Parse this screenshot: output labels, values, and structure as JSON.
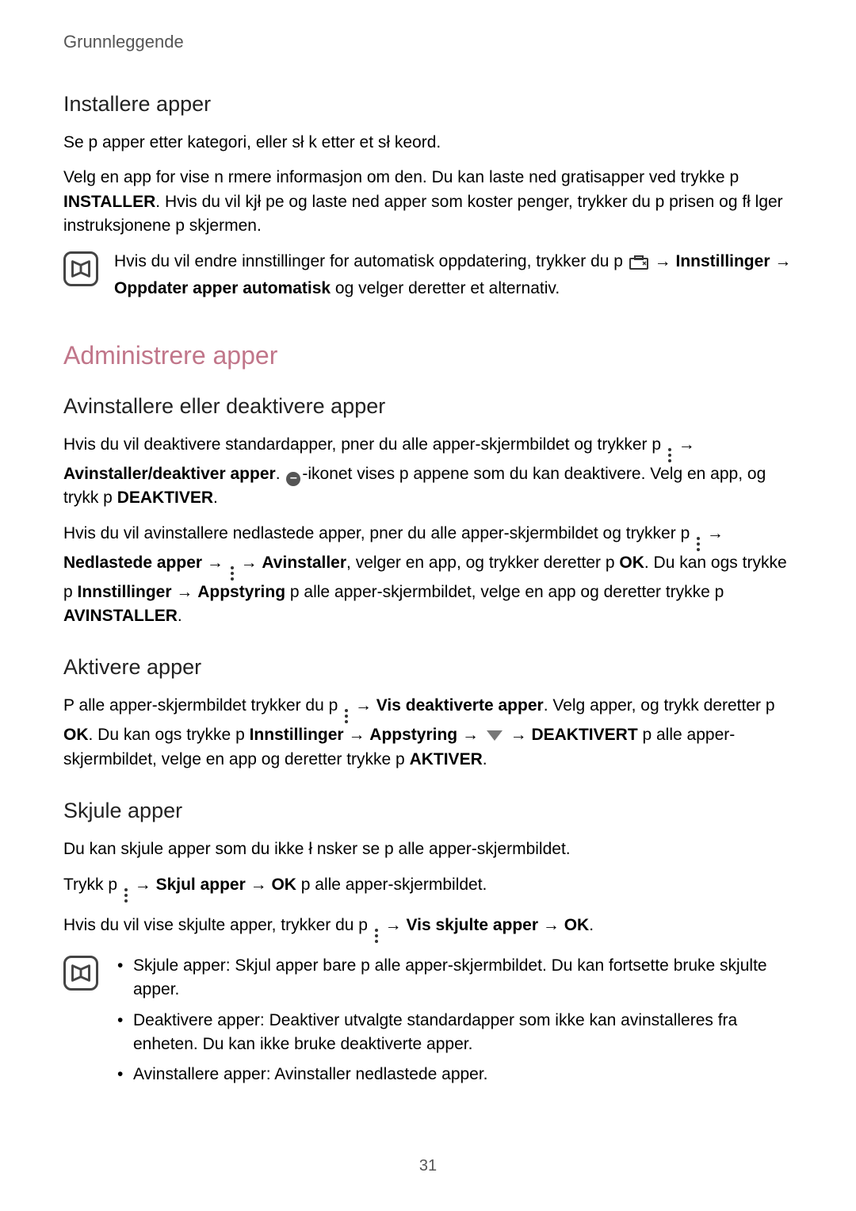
{
  "header": "Grunnleggende",
  "s1": {
    "title": "Installere apper",
    "p1": "Se p  apper etter kategori, eller sł k etter et sł keord.",
    "p2_a": "Velg en app for  vise n  rmere informasjon om den. Du kan laste ned gratisapper ved  trykke p  ",
    "p2_b": "INSTALLER",
    "p2_c": ". Hvis du vil kjł pe og laste ned apper som koster penger, trykker du p  prisen og fł lger instruksjonene p  skjermen.",
    "note_a": "Hvis du vil endre innstillinger for automatisk oppdatering, trykker du p  ",
    "note_b": "Innstillinger",
    "note_c": "Oppdater apper automatisk",
    "note_d": " og velger deretter et alternativ."
  },
  "admin_title": "Administrere apper",
  "s2": {
    "title": "Avinstallere eller deaktivere apper",
    "p1_a": "Hvis du vil deaktivere standardapper,  pner du alle apper-skjermbildet og trykker p  ",
    "p1_b": "Avinstaller/deaktiver apper",
    "p1_c": ". ",
    "p1_d": "-ikonet vises p  appene som du kan deaktivere. Velg en app, og trykk p  ",
    "p1_e": "DEAKTIVER",
    "p1_f": ".",
    "p2_a": "Hvis du vil avinstallere nedlastede apper,  pner du alle apper-skjermbildet og trykker p  ",
    "p2_b": "Nedlastede apper",
    "p2_c": "Avinstaller",
    "p2_d": ", velger en app, og trykker deretter p  ",
    "p2_e": "OK",
    "p2_f": ". Du kan ogs  trykke p  ",
    "p2_g": "Innstillinger",
    "p2_h": "Appstyring",
    "p2_i": " p  alle apper-skjermbildet, velge en app og deretter trykke p  ",
    "p2_j": "AVINSTALLER",
    "p2_k": "."
  },
  "s3": {
    "title": "Aktivere apper",
    "p1_a": "P  alle apper-skjermbildet trykker du p  ",
    "p1_b": "Vis deaktiverte apper",
    "p1_c": ". Velg apper, og trykk deretter p  ",
    "p1_d": "OK",
    "p1_e": ". Du kan ogs  trykke p  ",
    "p1_f": "Innstillinger",
    "p1_g": "Appstyring",
    "p1_h": "DEAKTIVERT",
    "p1_i": " p  alle apper-skjermbildet, velge en app og deretter trykke p  ",
    "p1_j": "AKTIVER",
    "p1_k": "."
  },
  "s4": {
    "title": "Skjule apper",
    "p1": "Du kan skjule apper som du ikke ł nsker  se p  alle apper-skjermbildet.",
    "p2_a": "Trykk p  ",
    "p2_b": "Skjul apper",
    "p2_c": "OK",
    "p2_d": " p  alle apper-skjermbildet.",
    "p3_a": "Hvis du vil vise skjulte apper, trykker du p  ",
    "p3_b": "Vis skjulte apper",
    "p3_c": "OK",
    "p3_d": ".",
    "li1": "Skjule apper: Skjul apper bare p  alle apper-skjermbildet. Du kan fortsette  bruke skjulte apper.",
    "li2": "Deaktivere apper: Deaktiver utvalgte standardapper som ikke kan avinstalleres fra enheten. Du kan ikke bruke deaktiverte apper.",
    "li3": "Avinstallere apper: Avinstaller nedlastede apper."
  },
  "arrow": " → ",
  "page": "31"
}
